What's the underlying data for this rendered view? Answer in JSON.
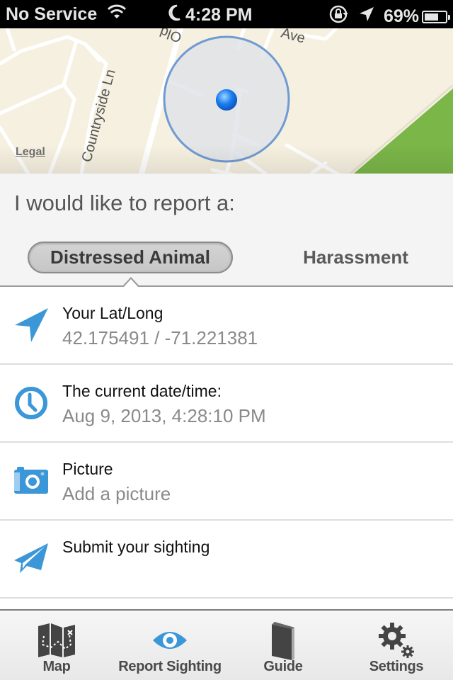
{
  "status_bar": {
    "carrier": "No Service",
    "time": "4:28 PM",
    "battery": "69%",
    "battery_level": 0.69,
    "icons": [
      "wifi-icon",
      "moon-icon",
      "rotation-lock-icon",
      "location-arrow-icon",
      "battery-icon"
    ]
  },
  "map": {
    "labels": {
      "street_1": "Old",
      "street_2": "Ave",
      "street_3": "Countryside Ln"
    },
    "legal": "Legal"
  },
  "report": {
    "title": "I would like to report a:",
    "segments": [
      {
        "label": "Distressed Animal",
        "selected": true
      },
      {
        "label": "Harassment",
        "selected": false
      }
    ]
  },
  "rows": [
    {
      "icon": "location-arrow-icon",
      "title": "Your Lat/Long",
      "value": "42.175491 / -71.221381"
    },
    {
      "icon": "clock-icon",
      "title": "The current date/time:",
      "value": "Aug 9, 2013, 4:28:10 PM"
    },
    {
      "icon": "camera-icon",
      "title": "Picture",
      "value": "Add a picture"
    },
    {
      "icon": "paper-plane-icon",
      "title": "Submit your sighting",
      "value": ""
    }
  ],
  "tabs": [
    {
      "label": "Map",
      "icon": "map-icon",
      "active": false
    },
    {
      "label": "Report Sighting",
      "icon": "eye-icon",
      "active": true
    },
    {
      "label": "Guide",
      "icon": "book-icon",
      "active": false
    },
    {
      "label": "Settings",
      "icon": "gears-icon",
      "active": false
    }
  ],
  "colors": {
    "accent": "#3c97d8",
    "tab_inactive": "#444444",
    "map_bg": "#f6f0e0",
    "park": "#7ab648"
  }
}
